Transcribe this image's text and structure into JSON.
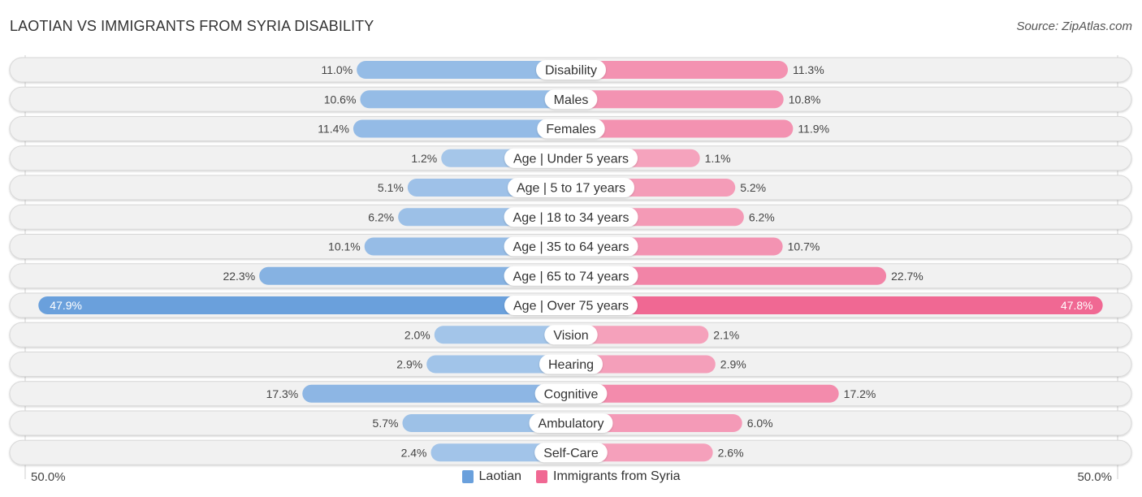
{
  "header": {
    "title": "LAOTIAN VS IMMIGRANTS FROM SYRIA DISABILITY",
    "source": "Source: ZipAtlas.com"
  },
  "colors": {
    "laotian": "#6aa0dc",
    "laotian_light": "#a8c8ea",
    "syria": "#f06893",
    "syria_light": "#f5a6bf",
    "track": "#f1f1f1",
    "track_border": "#d8d8d8"
  },
  "axis": {
    "left_label": "50.0%",
    "right_label": "50.0%"
  },
  "legend": [
    {
      "label": "Laotian",
      "color": "#6aa0dc"
    },
    {
      "label": "Immigrants from Syria",
      "color": "#f06893"
    }
  ],
  "chart_data": {
    "type": "bar",
    "orientation": "horizontal-diverging",
    "title": "LAOTIAN VS IMMIGRANTS FROM SYRIA DISABILITY",
    "xlabel": "",
    "ylabel": "",
    "xlim": [
      -50,
      50
    ],
    "legend_position": "bottom",
    "categories": [
      "Disability",
      "Males",
      "Females",
      "Age | Under 5 years",
      "Age | 5 to 17 years",
      "Age | 18 to 34 years",
      "Age | 35 to 64 years",
      "Age | 65 to 74 years",
      "Age | Over 75 years",
      "Vision",
      "Hearing",
      "Cognitive",
      "Ambulatory",
      "Self-Care"
    ],
    "series": [
      {
        "name": "Laotian",
        "side": "left",
        "values": [
          11.0,
          10.6,
          11.4,
          1.2,
          5.1,
          6.2,
          10.1,
          22.3,
          47.9,
          2.0,
          2.9,
          17.3,
          5.7,
          2.4
        ],
        "labels": [
          "11.0%",
          "10.6%",
          "11.4%",
          "1.2%",
          "5.1%",
          "6.2%",
          "10.1%",
          "22.3%",
          "47.9%",
          "2.0%",
          "2.9%",
          "17.3%",
          "5.7%",
          "2.4%"
        ]
      },
      {
        "name": "Immigrants from Syria",
        "side": "right",
        "values": [
          11.3,
          10.8,
          11.9,
          1.1,
          5.2,
          6.2,
          10.7,
          22.7,
          47.8,
          2.1,
          2.9,
          17.2,
          6.0,
          2.6
        ],
        "labels": [
          "11.3%",
          "10.8%",
          "11.9%",
          "1.1%",
          "5.2%",
          "6.2%",
          "10.7%",
          "22.7%",
          "47.8%",
          "2.1%",
          "2.9%",
          "17.2%",
          "6.0%",
          "2.6%"
        ]
      }
    ]
  }
}
